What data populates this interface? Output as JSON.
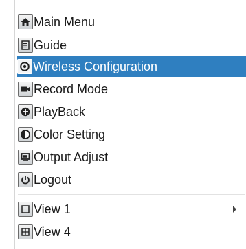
{
  "menu": {
    "items": [
      {
        "label": "Main Menu",
        "icon": "home-icon"
      },
      {
        "label": "Guide",
        "icon": "document-icon"
      },
      {
        "label": "Wireless Configuration",
        "icon": "wireless-icon",
        "selected": true
      },
      {
        "label": "Record Mode",
        "icon": "video-camera-icon"
      },
      {
        "label": "PlayBack",
        "icon": "playback-icon"
      },
      {
        "label": "Color Setting",
        "icon": "color-contrast-icon"
      },
      {
        "label": "Output Adjust",
        "icon": "monitor-icon"
      },
      {
        "label": "Logout",
        "icon": "power-icon"
      },
      {
        "label": "View 1",
        "icon": "single-view-icon",
        "has_submenu": true
      },
      {
        "label": "View 4",
        "icon": "quad-view-icon"
      }
    ]
  },
  "colors": {
    "selected_background": "#2f7fc0",
    "selected_text": "#ffffff",
    "text": "#1a1a1a"
  }
}
